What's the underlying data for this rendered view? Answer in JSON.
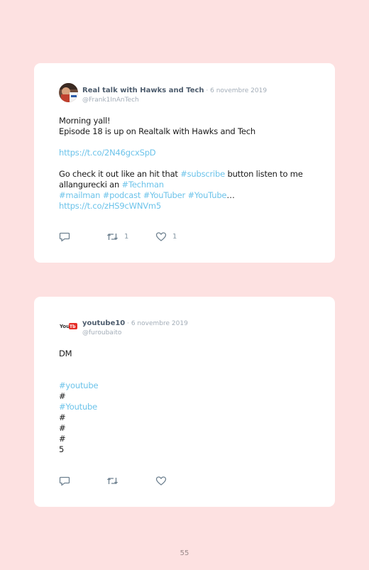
{
  "tweets": [
    {
      "name": "Real talk with Hawks and Tech",
      "date": " · 6 novembre 2019",
      "handle": "@Frank1InAnTech",
      "avatar_icon": "profile-photo",
      "lines": [
        [
          {
            "t": "Morning yall!"
          }
        ],
        [
          {
            "t": "Episode 18 is up on Realtalk with Hawks and Tech"
          }
        ],
        [],
        [
          {
            "t": "https://t.co/2N46gcxSpD",
            "link": true
          }
        ],
        [],
        [
          {
            "t": "Go check it out like an hit that "
          },
          {
            "t": "#subscribe",
            "link": true
          },
          {
            "t": " button listen to me"
          }
        ],
        [
          {
            "t": "allangurecki an "
          },
          {
            "t": "#Techman",
            "link": true
          }
        ],
        [
          {
            "t": "#mailman",
            "link": true
          },
          {
            "t": " "
          },
          {
            "t": "#podcast",
            "link": true
          },
          {
            "t": " "
          },
          {
            "t": "#YouTuber",
            "link": true
          },
          {
            "t": " "
          },
          {
            "t": "#YouTube",
            "link": true
          },
          {
            "t": "…"
          }
        ],
        [
          {
            "t": "https://t.co/zHS9cWNVm5",
            "link": true
          }
        ]
      ],
      "retweets": "1",
      "likes": "1"
    },
    {
      "name": "youtube10",
      "date": " · 6 novembre 2019",
      "handle": "@furoubaito",
      "avatar_icon": "youtube-logo",
      "lines": [
        [
          {
            "t": "DM"
          }
        ],
        [],
        [],
        [
          {
            "t": "#youtube",
            "link": true
          }
        ],
        [
          {
            "t": "#"
          }
        ],
        [
          {
            "t": "#Youtube",
            "link": true
          }
        ],
        [
          {
            "t": "#"
          }
        ],
        [
          {
            "t": "#"
          }
        ],
        [
          {
            "t": "#"
          }
        ],
        [
          {
            "t": "5"
          }
        ]
      ],
      "retweets": "",
      "likes": ""
    }
  ],
  "colors": {
    "background": "#fde1e1",
    "card": "#ffffff",
    "link": "#6cc3ea",
    "muted": "#a3adb8"
  },
  "page_number": "55"
}
